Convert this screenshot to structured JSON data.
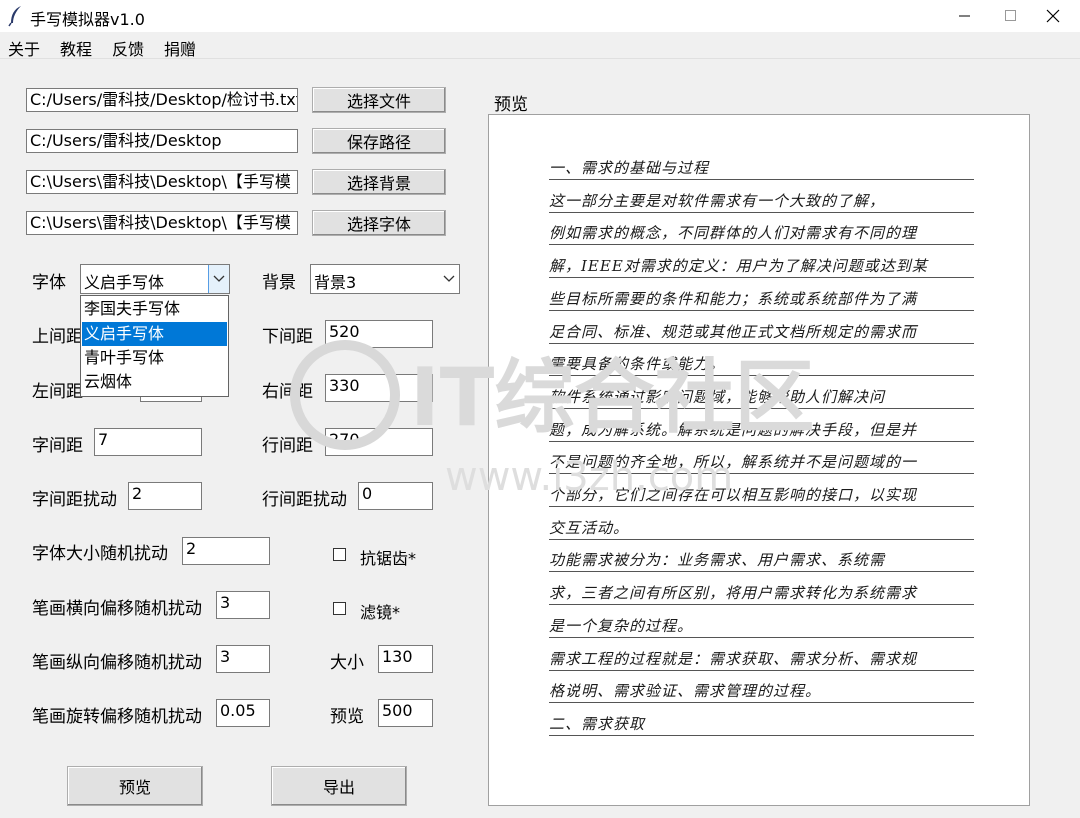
{
  "window": {
    "title": "手写模拟器v1.0"
  },
  "menu": [
    "关于",
    "教程",
    "反馈",
    "捐赠"
  ],
  "files": [
    {
      "path": "C:/Users/雷科技/Desktop/检讨书.txt",
      "button": "选择文件"
    },
    {
      "path": "C:/Users/雷科技/Desktop",
      "button": "保存路径"
    },
    {
      "path": "C:\\Users\\雷科技\\Desktop\\【手写模",
      "button": "选择背景"
    },
    {
      "path": "C:\\Users\\雷科技\\Desktop\\【手写模",
      "button": "选择字体"
    }
  ],
  "font": {
    "label": "字体",
    "selected": "义启手写体",
    "options": [
      "李国夫手写体",
      "义启手写体",
      "青叶手写体",
      "云烟体"
    ],
    "highlighted_index": 1
  },
  "background": {
    "label": "背景",
    "selected": "背景3"
  },
  "params": {
    "top_margin": {
      "label": "上间距",
      "value": ""
    },
    "bottom_margin": {
      "label": "下间距",
      "value": "520"
    },
    "left_margin": {
      "label": "左间距",
      "value": ""
    },
    "right_margin": {
      "label": "右间距",
      "value": "330"
    },
    "char_spacing": {
      "label": "字间距",
      "value": "7"
    },
    "line_spacing": {
      "label": "行间距",
      "value": "270"
    },
    "char_spacing_jitter": {
      "label": "字间距扰动",
      "value": "2"
    },
    "line_spacing_jitter": {
      "label": "行间距扰动",
      "value": "0"
    },
    "font_size_jitter": {
      "label": "字体大小随机扰动",
      "value": "2"
    },
    "stroke_h_jitter": {
      "label": "笔画横向偏移随机扰动",
      "value": "3"
    },
    "stroke_v_jitter": {
      "label": "笔画纵向偏移随机扰动",
      "value": "3"
    },
    "stroke_rot_jitter": {
      "label": "笔画旋转偏移随机扰动",
      "value": "0.05"
    },
    "size": {
      "label": "大小",
      "value": "130"
    },
    "preview_res": {
      "label": "预览",
      "value": "500"
    }
  },
  "checkboxes": {
    "antialias": {
      "label": "抗锯齿*",
      "checked": false
    },
    "filter": {
      "label": "滤镜*",
      "checked": false
    }
  },
  "buttons": {
    "preview": "预览",
    "export": "导出"
  },
  "preview": {
    "label": "预览",
    "lines": [
      "一、需求的基础与过程",
      "    这一部分主要是对软件需求有一个大致的了解，",
      "例如需求的概念，不同群体的人们对需求有不同的理",
      "解，IEEE对需求的定义：用户为了解决问题或达到某",
      "些目标所需要的条件和能力；系统或系统部件为了满",
      "足合同、标准、规范或其他正式文档所规定的需求而",
      "需要具备的条件或能力。",
      "    软件系统通过影响问题域，能够帮助人们解决问",
      "题，成为解系统。解系统是问题的解决手段，但是并",
      "不是问题的齐全地，所以，解系统并不是问题域的一",
      "个部分，它们之间存在可以相互影响的接口，以实现",
      "交互活动。",
      "    功能需求被分为：业务需求、用户需求、系统需",
      "求，三者之间有所区别，将用户需求转化为系统需求",
      "是一个复杂的过程。",
      "需求工程的过程就是：需求获取、需求分析、需求规",
      "格说明、需求验证、需求管理的过程。",
      "二、需求获取"
    ]
  },
  "watermark": {
    "text": "IT综合社区",
    "url": "www.i3zh.com"
  }
}
